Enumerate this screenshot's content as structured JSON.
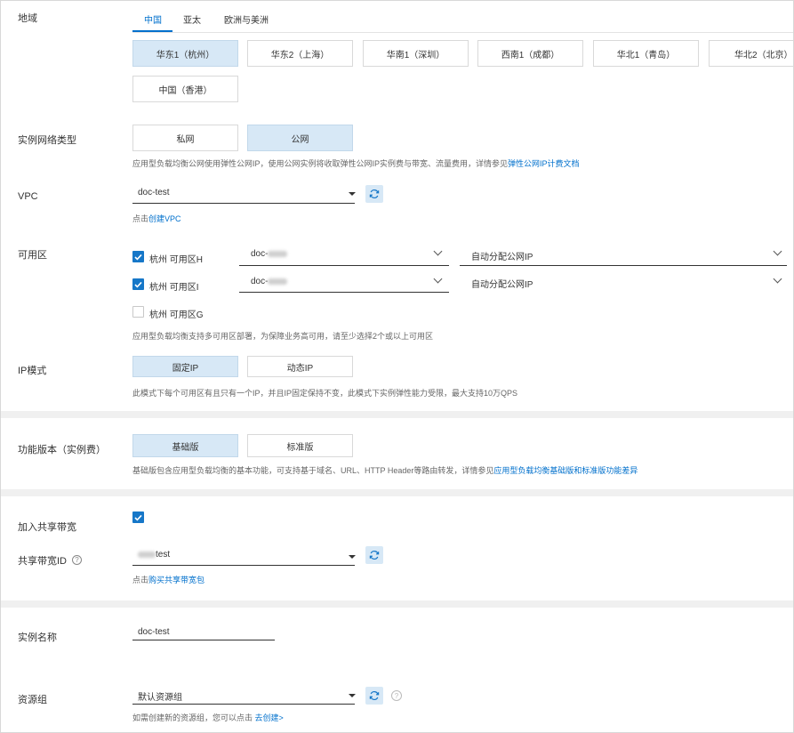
{
  "region": {
    "label": "地域",
    "tabs": [
      "中国",
      "亚太",
      "欧洲与美洲"
    ],
    "options": [
      "华东1（杭州）",
      "华东2（上海）",
      "华南1（深圳）",
      "西南1（成都）",
      "华北1（青岛）",
      "华北2（北京）",
      "中国（香港）"
    ],
    "selected": "华东1（杭州）"
  },
  "network_type": {
    "label": "实例网络类型",
    "options": [
      "私网",
      "公网"
    ],
    "selected": "公网",
    "hint": "应用型负载均衡公网使用弹性公网IP，使用公网实例将收取弹性公网IP实例费与带宽、流量费用，详情参见",
    "hint_link": "弹性公网IP计费文档"
  },
  "vpc": {
    "label": "VPC",
    "value": "doc-test",
    "hint": "点击",
    "hint_link": "创建VPC"
  },
  "zones": {
    "label": "可用区",
    "items": [
      {
        "name": "杭州 可用区H",
        "checked": true,
        "vswitch": "doc-",
        "ip": "自动分配公网IP"
      },
      {
        "name": "杭州 可用区I",
        "checked": true,
        "vswitch": "doc-",
        "ip": "自动分配公网IP"
      },
      {
        "name": "杭州 可用区G",
        "checked": false
      }
    ],
    "hint": "应用型负载均衡支持多可用区部署，为保障业务高可用，请至少选择2个或以上可用区"
  },
  "ip_mode": {
    "label": "IP模式",
    "options": [
      "固定IP",
      "动态IP"
    ],
    "selected": "固定IP",
    "hint": "此模式下每个可用区有且只有一个IP，并且IP固定保持不变，此模式下实例弹性能力受限，最大支持10万QPS"
  },
  "edition": {
    "label": "功能版本（实例费）",
    "options": [
      "基础版",
      "标准版"
    ],
    "selected": "基础版",
    "hint": "基础版包含应用型负载均衡的基本功能，可支持基于域名、URL、HTTP Header等路由转发，详情参见",
    "hint_link": "应用型负载均衡基础版和标准版功能差异"
  },
  "shared_bandwidth": {
    "label": "加入共享带宽",
    "checked": true,
    "id_label": "共享带宽ID",
    "id_value": "test",
    "hint": "点击",
    "hint_link": "购买共享带宽包"
  },
  "instance_name": {
    "label": "实例名称",
    "value": "doc-test"
  },
  "resource_group": {
    "label": "资源组",
    "value": "默认资源组",
    "hint": "如需创建新的资源组，您可以点击 ",
    "hint_link": "去创建>"
  },
  "colors": {
    "accent": "#0070cc",
    "selected_bg": "#d7e8f6",
    "checkbox": "#1677c8"
  }
}
